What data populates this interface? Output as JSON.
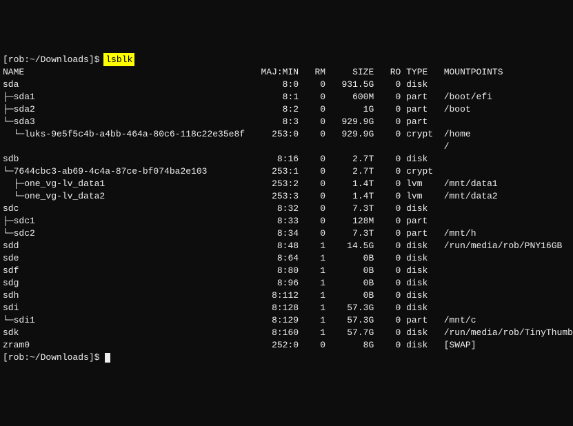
{
  "prompt": {
    "user_host": "[rob:~/Downloads]$",
    "command": "lsblk",
    "trailing_prompt": "[rob:~/Downloads]$ "
  },
  "headers": {
    "name": "NAME",
    "majmin": "MAJ:MIN",
    "rm": "RM",
    "size": "SIZE",
    "ro": "RO",
    "type": "TYPE",
    "mount": "MOUNTPOINTS"
  },
  "rows": [
    {
      "tree": "",
      "name": "sda",
      "majmin": "8:0",
      "rm": "0",
      "size": "931.5G",
      "ro": "0",
      "type": "disk",
      "mount": ""
    },
    {
      "tree": "├─",
      "name": "sda1",
      "majmin": "8:1",
      "rm": "0",
      "size": "600M",
      "ro": "0",
      "type": "part",
      "mount": "/boot/efi"
    },
    {
      "tree": "├─",
      "name": "sda2",
      "majmin": "8:2",
      "rm": "0",
      "size": "1G",
      "ro": "0",
      "type": "part",
      "mount": "/boot"
    },
    {
      "tree": "└─",
      "name": "sda3",
      "majmin": "8:3",
      "rm": "0",
      "size": "929.9G",
      "ro": "0",
      "type": "part",
      "mount": ""
    },
    {
      "tree": "  └─",
      "name": "luks-9e5f5c4b-a4bb-464a-80c6-118c22e35e8f",
      "majmin": "253:0",
      "rm": "0",
      "size": "929.9G",
      "ro": "0",
      "type": "crypt",
      "mount": "/home"
    },
    {
      "tree": "",
      "name": "",
      "majmin": "",
      "rm": "",
      "size": "",
      "ro": "",
      "type": "",
      "mount": "/"
    },
    {
      "tree": "",
      "name": "sdb",
      "majmin": "8:16",
      "rm": "0",
      "size": "2.7T",
      "ro": "0",
      "type": "disk",
      "mount": ""
    },
    {
      "tree": "└─",
      "name": "7644cbc3-ab69-4c4a-87ce-bf074ba2e103",
      "majmin": "253:1",
      "rm": "0",
      "size": "2.7T",
      "ro": "0",
      "type": "crypt",
      "mount": ""
    },
    {
      "tree": "  ├─",
      "name": "one_vg-lv_data1",
      "majmin": "253:2",
      "rm": "0",
      "size": "1.4T",
      "ro": "0",
      "type": "lvm",
      "mount": "/mnt/data1"
    },
    {
      "tree": "  └─",
      "name": "one_vg-lv_data2",
      "majmin": "253:3",
      "rm": "0",
      "size": "1.4T",
      "ro": "0",
      "type": "lvm",
      "mount": "/mnt/data2"
    },
    {
      "tree": "",
      "name": "sdc",
      "majmin": "8:32",
      "rm": "0",
      "size": "7.3T",
      "ro": "0",
      "type": "disk",
      "mount": ""
    },
    {
      "tree": "├─",
      "name": "sdc1",
      "majmin": "8:33",
      "rm": "0",
      "size": "128M",
      "ro": "0",
      "type": "part",
      "mount": ""
    },
    {
      "tree": "└─",
      "name": "sdc2",
      "majmin": "8:34",
      "rm": "0",
      "size": "7.3T",
      "ro": "0",
      "type": "part",
      "mount": "/mnt/h"
    },
    {
      "tree": "",
      "name": "sdd",
      "majmin": "8:48",
      "rm": "1",
      "size": "14.5G",
      "ro": "0",
      "type": "disk",
      "mount": "/run/media/rob/PNY16GB"
    },
    {
      "tree": "",
      "name": "sde",
      "majmin": "8:64",
      "rm": "1",
      "size": "0B",
      "ro": "0",
      "type": "disk",
      "mount": ""
    },
    {
      "tree": "",
      "name": "sdf",
      "majmin": "8:80",
      "rm": "1",
      "size": "0B",
      "ro": "0",
      "type": "disk",
      "mount": ""
    },
    {
      "tree": "",
      "name": "sdg",
      "majmin": "8:96",
      "rm": "1",
      "size": "0B",
      "ro": "0",
      "type": "disk",
      "mount": ""
    },
    {
      "tree": "",
      "name": "sdh",
      "majmin": "8:112",
      "rm": "1",
      "size": "0B",
      "ro": "0",
      "type": "disk",
      "mount": ""
    },
    {
      "tree": "",
      "name": "sdi",
      "majmin": "8:128",
      "rm": "1",
      "size": "57.3G",
      "ro": "0",
      "type": "disk",
      "mount": ""
    },
    {
      "tree": "└─",
      "name": "sdi1",
      "majmin": "8:129",
      "rm": "1",
      "size": "57.3G",
      "ro": "0",
      "type": "part",
      "mount": "/mnt/c"
    },
    {
      "tree": "",
      "name": "sdk",
      "majmin": "8:160",
      "rm": "1",
      "size": "57.7G",
      "ro": "0",
      "type": "disk",
      "mount": "/run/media/rob/TinyThumb"
    },
    {
      "tree": "",
      "name": "zram0",
      "majmin": "252:0",
      "rm": "0",
      "size": "8G",
      "ro": "0",
      "type": "disk",
      "mount": "[SWAP]"
    }
  ]
}
